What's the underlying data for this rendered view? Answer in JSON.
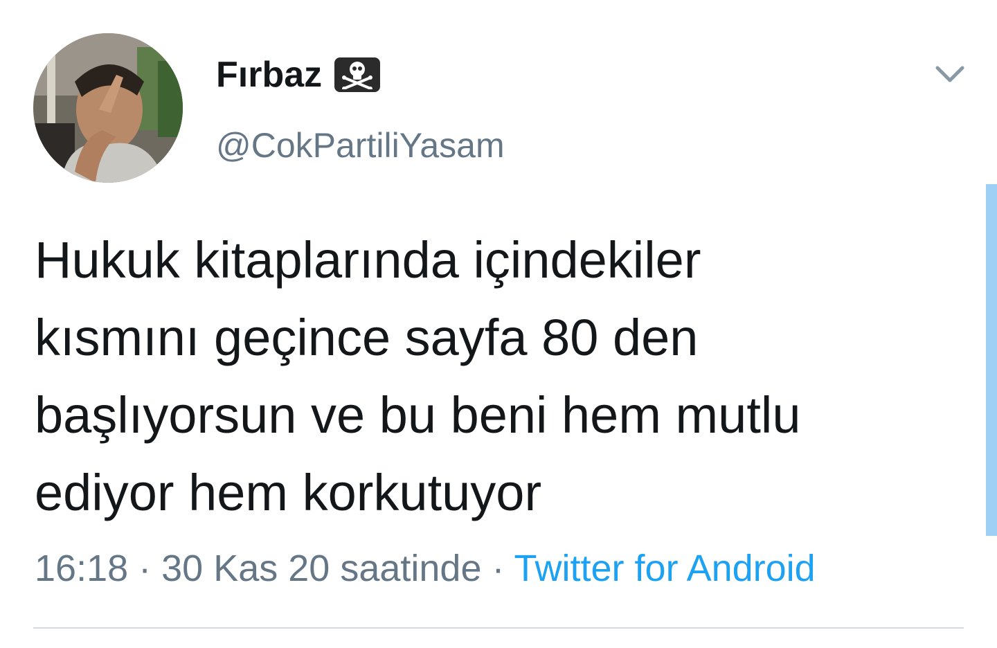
{
  "user": {
    "display_name": "Fırbaz",
    "badge_icon": "skull-crossbones-icon",
    "handle": "@CokPartiliYasam"
  },
  "tweet": {
    "lines": [
      "Hukuk kitaplarında içindekiler",
      "kısmını geçince sayfa 80 den",
      "başlıyorsun ve bu beni hem mutlu",
      "ediyor hem korkutuyor"
    ]
  },
  "meta": {
    "time": "16:18",
    "separator": " · ",
    "date": "30 Kas 20 saatinde",
    "source": "Twitter for Android"
  },
  "colors": {
    "text": "#14171a",
    "secondary": "#657786",
    "link": "#1da1f2",
    "divider": "#d5dbe0"
  }
}
